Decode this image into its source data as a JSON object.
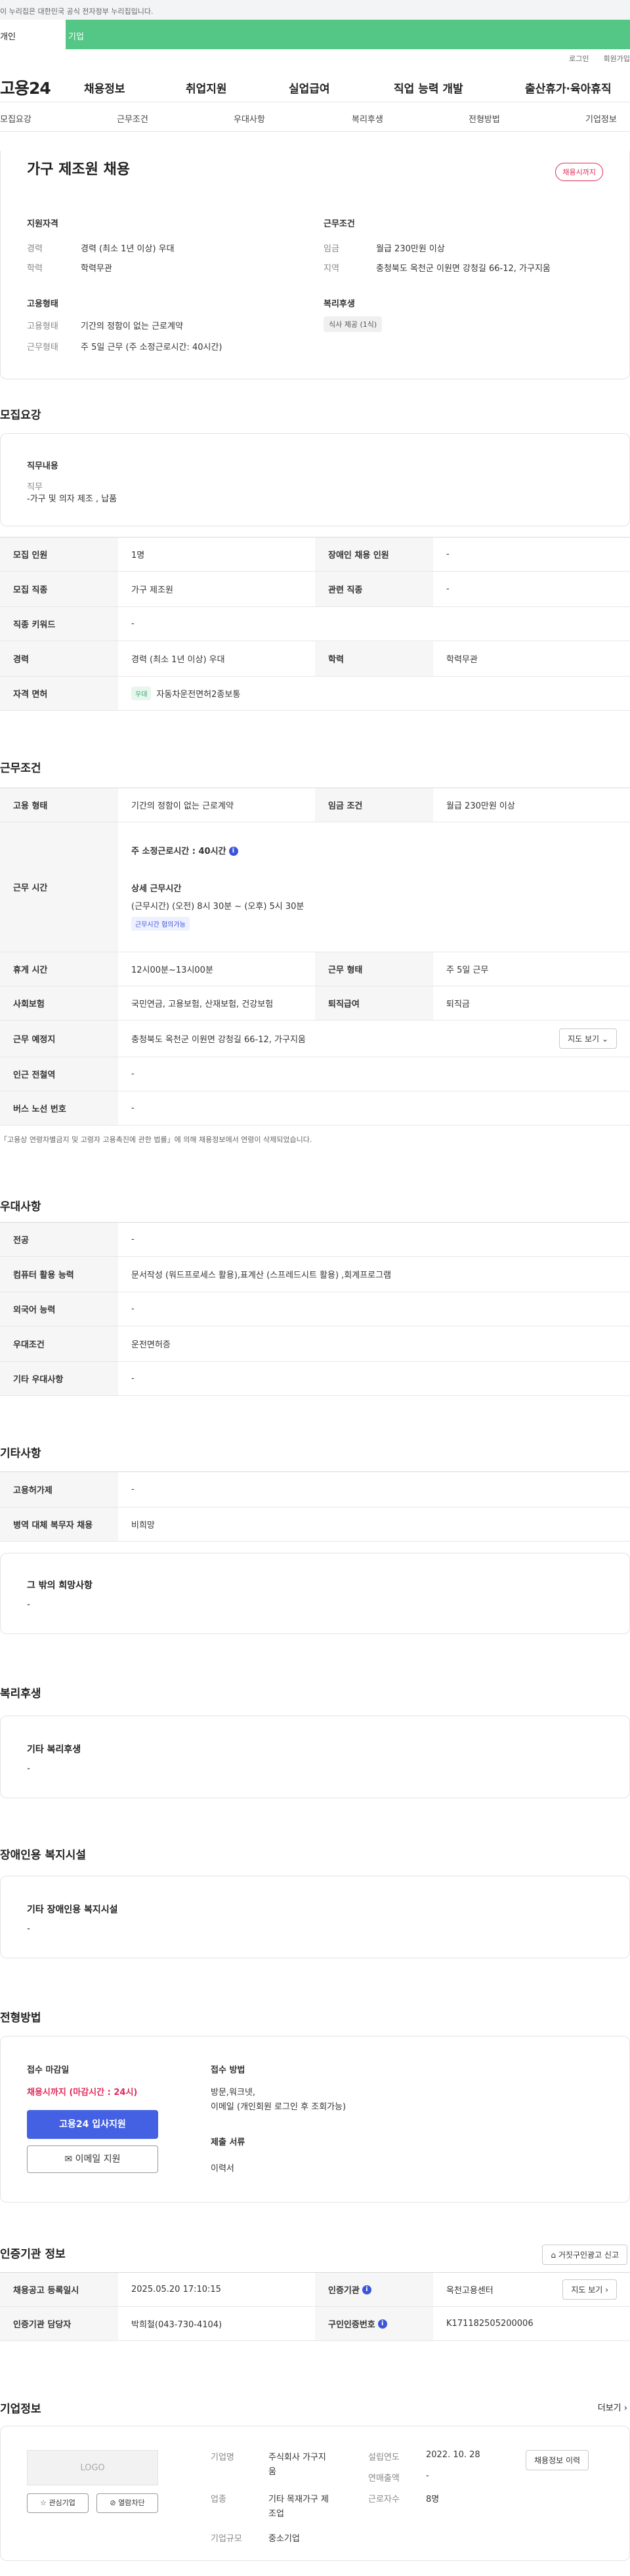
{
  "banner": {
    "gov_notice": "이 누리집은 대한민국 공식 전자정부 누리집입니다."
  },
  "login_tabs": {
    "personal": "개인",
    "corporate": "기업"
  },
  "util": {
    "login": "로그인",
    "join": "회원가입"
  },
  "gnb": {
    "logo": "고용24",
    "items": [
      "채용정보",
      "취업지원",
      "실업급여",
      "직업 능력 개발",
      "출산휴가·육아휴직"
    ]
  },
  "tabs": [
    "모집요강",
    "근무조건",
    "우대사항",
    "복리후생",
    "전형방법",
    "기업정보"
  ],
  "summary": {
    "title": "가구 제조원 채용",
    "badge": "채용시까지",
    "qual_title": "지원자격",
    "career_k": "경력",
    "career_v": "경력 (최소 1년 이상) 우대",
    "edu_k": "학력",
    "edu_v": "학력무관",
    "emp_title": "고용형태",
    "emptype_k": "고용형태",
    "emptype_v": "기간의 정함이 없는 근로계약",
    "worktype_k": "근무형태",
    "worktype_v": "주 5일 근무 (주 소정근로시간: 40시간)",
    "cond_title": "근무조건",
    "wage_k": "임금",
    "wage_v": "월급 230만원 이상",
    "region_k": "지역",
    "region_v": "충청북도 옥천군 이원면 강청길 66-12, 가구지움",
    "welfare_title": "복리후생",
    "welfare_chip": "식사 제공 (1식)"
  },
  "recruit": {
    "section": "모집요강",
    "duty_title": "직무내용",
    "duty_label": "직무",
    "duty_value": "-가구 및 의자 제조 , 납품",
    "rows": {
      "headcount_k": "모집 인원",
      "headcount_v": "1명",
      "disabled_k": "장애인 채용 인원",
      "disabled_v": "-",
      "job_k": "모집 직종",
      "job_v": "가구 제조원",
      "related_k": "관련 직종",
      "related_v": "-",
      "keyword_k": "직종 키워드",
      "keyword_v": "-",
      "career_k": "경력",
      "career_v": "경력 (최소 1년 이상) 우대",
      "edu_k": "학력",
      "edu_v": "학력무관",
      "license_k": "자격 면허",
      "license_chip": "우대",
      "license_v": "자동차운전면허2종보통"
    }
  },
  "conditions": {
    "section": "근무조건",
    "emptype_k": "고용 형태",
    "emptype_v": "기간의 정함이 없는 근로계약",
    "wage_k": "임금 조건",
    "wage_v": "월급 230만원 이상",
    "hours_k": "근무 시간",
    "hours_weekly": "주 소정근로시간 : 40시간",
    "hours_detail_title": "상세 근무시간",
    "hours_detail": "(근무시간) (오전) 8시 30분 ~ (오후) 5시 30분",
    "hours_chip": "근무시간 협의가능",
    "break_k": "휴게 시간",
    "break_v": "12시00분~13시00분",
    "worktype_k": "근무 형태",
    "worktype_v": "주 5일 근무",
    "insurance_k": "사회보험",
    "insurance_v": "국민연금, 고용보험, 산재보험, 건강보험",
    "severance_k": "퇴직급여",
    "severance_v": "퇴직금",
    "location_k": "근무 예정지",
    "location_v": "충청북도 옥천군 이원면 강청길 66-12, 가구지움",
    "map_btn": "지도 보기",
    "station_k": "인근 전철역",
    "station_v": "-",
    "bus_k": "버스 노선 번호",
    "bus_v": "-",
    "note": "「고용상 연령차별금지 및 고령자 고용촉진에 관한 법률」에 의해 채용정보에서 연령이 삭제되었습니다."
  },
  "preference": {
    "section": "우대사항",
    "major_k": "전공",
    "major_v": "-",
    "computer_k": "컴퓨터 활용 능력",
    "computer_v": "문서작성 (워드프로세스 활용),표계산 (스프레드시트 활용) ,회계프로그램",
    "lang_k": "외국어 능력",
    "lang_v": "-",
    "pref_k": "우대조건",
    "pref_v": "운전면허증",
    "etc_k": "기타 우대사항",
    "etc_v": "-"
  },
  "etc": {
    "section": "기타사항",
    "insurance_k": "고용허가제",
    "insurance_v": "-",
    "military_k": "병역 대체 복무자 채용",
    "military_v": "비희망",
    "other_title": "그 밖의 희망사항",
    "other_v": "-"
  },
  "welfare": {
    "section": "복리후생",
    "title": "기타 복리후생",
    "value": "-"
  },
  "disabled_facility": {
    "section": "장애인용 복지시설",
    "title": "기타 장애인용 복지시설",
    "value": "-"
  },
  "process": {
    "section": "전형방법",
    "deadline_title": "접수 마감일",
    "deadline_value": "채용시까지 (마감시간 : 24시)",
    "apply_btn": "고용24 입사지원",
    "email_btn": "이메일 지원",
    "method_title": "접수 방법",
    "method_value_1": "방문,워크넷,",
    "method_value_2": "이메일 (개인회원 로그인 후 조회가능)",
    "doc_title": "제출 서류",
    "doc_value": "이력서"
  },
  "agency": {
    "section": "인증기관 정보",
    "report_btn": "거짓구인광고 신고",
    "reg_date_k": "채용공고 등록일시",
    "reg_date_v": "2025.05.20 17:10:15",
    "org_k": "인증기관",
    "org_v": "옥천고용센터",
    "manager_k": "인증기관 담당자",
    "manager_v": "박희철(043-730-4104)",
    "num_k": "구인인증번호",
    "num_v": "K171182505200006",
    "map_btn": "지도 보기"
  },
  "company": {
    "section": "기업정보",
    "more": "더보기",
    "logo": "LOGO",
    "fav_btn": "관심기업",
    "block_btn": "열람차단",
    "name_k": "기업명",
    "name_v1": "주식회사 가구지",
    "name_v2": "움",
    "industry_k": "업종",
    "industry_v1": "기타 목재가구 제",
    "industry_v2": "조업",
    "size_k": "기업규모",
    "size_v": "중소기업",
    "founded_k": "설립연도",
    "founded_v": "2022. 10. 28",
    "sales_k": "연매출액",
    "sales_v": "-",
    "employees_k": "근로자수",
    "employees_v": "8명",
    "history_btn": "채용정보 이력"
  }
}
